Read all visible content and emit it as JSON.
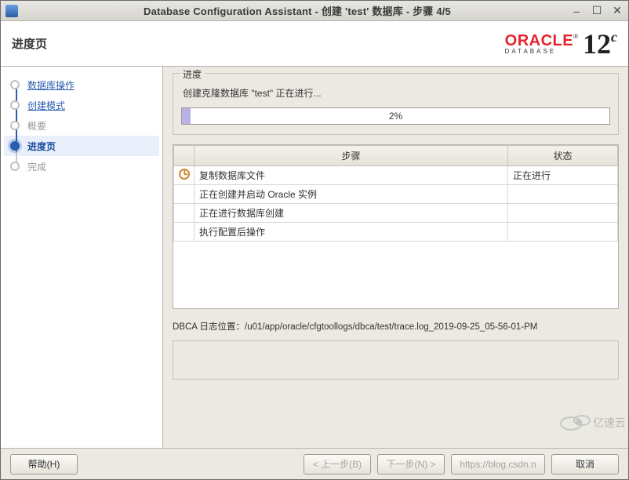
{
  "window": {
    "title": "Database Configuration Assistant - 创建  'test' 数据库  -  步骤  4/5"
  },
  "header": {
    "page_title": "进度页",
    "brand_word": "ORACLE",
    "brand_reg": "®",
    "brand_sub": "DATABASE",
    "brand_version": "12",
    "brand_version_sup": "c"
  },
  "sidebar": {
    "items": [
      {
        "label": "数据库操作",
        "state": "done-link"
      },
      {
        "label": "创建模式",
        "state": "done-link"
      },
      {
        "label": "概要",
        "state": "disabled"
      },
      {
        "label": "进度页",
        "state": "active"
      },
      {
        "label": "完成",
        "state": "pending"
      }
    ]
  },
  "progress": {
    "group_label": "进度",
    "status_text": "创建克隆数据库 \"test\" 正在进行...",
    "percent_text": "2%",
    "percent_value": 2
  },
  "table": {
    "col_step": "步骤",
    "col_status": "状态",
    "rows": [
      {
        "step": "复制数据库文件",
        "status": "正在进行",
        "icon": "clock"
      },
      {
        "step": "正在创建并启动 Oracle 实例",
        "status": "",
        "icon": ""
      },
      {
        "step": "正在进行数据库创建",
        "status": "",
        "icon": ""
      },
      {
        "step": "执行配置后操作",
        "status": "",
        "icon": ""
      }
    ]
  },
  "log": {
    "text": "DBCA 日志位置：/u01/app/oracle/cfgtoollogs/dbca/test/trace.log_2019-09-25_05-56-01-PM"
  },
  "footer": {
    "help": "帮助(H)",
    "back": "< 上一步(B)",
    "next": "下一步(N) >",
    "finish_hidden": "https://blog.csdn.n",
    "cancel": "取消"
  },
  "watermark": "亿速云"
}
